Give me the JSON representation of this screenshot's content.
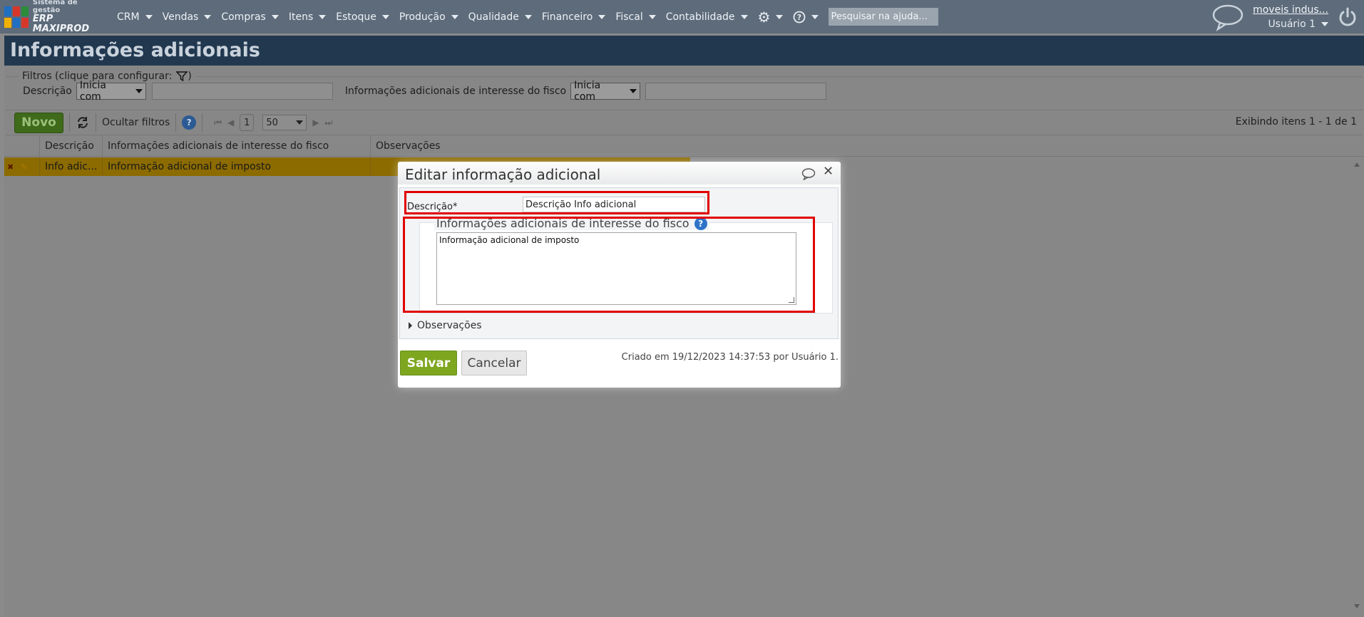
{
  "brand": {
    "line1": "Sistema de gestão",
    "line2": "ERP MAXIPROD",
    "colors": [
      "#1f6fc2",
      "#d7372b",
      "#2b8c3a",
      "#f2b100"
    ]
  },
  "nav": {
    "items": [
      "CRM",
      "Vendas",
      "Compras",
      "Itens",
      "Estoque",
      "Produção",
      "Qualidade",
      "Financeiro",
      "Fiscal",
      "Contabilidade"
    ],
    "settings_icon": "gear-icon",
    "help_icon": "help-circle-icon",
    "help_search_placeholder": "Pesquisar na ajuda..."
  },
  "account": {
    "company": "moveis indus...",
    "user": "Usuário 1"
  },
  "page": {
    "title": "Informações adicionais"
  },
  "filters": {
    "legend": "Filtros (clique para configurar:",
    "legend_close": ")",
    "field1_label": "Descrição",
    "field1_operator": "Inicia com",
    "field2_label": "Informações adicionais de interesse do fisco",
    "field2_operator": "Inicia com"
  },
  "toolbar": {
    "new_label": "Novo",
    "hide_filters_label": "Ocultar filtros",
    "page_number": "1",
    "per_page": "50",
    "count_text": "Exibindo itens 1 - 1 de 1"
  },
  "grid": {
    "columns": [
      "Descrição",
      "Informações adicionais de interesse do fisco",
      "Observações"
    ],
    "rows": [
      {
        "descricao": "Info adic...",
        "fisco": "Informação adicional de imposto",
        "obs": ""
      }
    ]
  },
  "modal": {
    "title": "Editar informação adicional",
    "desc_label": "Descrição*",
    "desc_value": "Descrição Info adicional",
    "fisco_legend": "Informações adicionais de interesse do fisco",
    "fisco_value": "Informação adicional de imposto",
    "obs_label": "Observações",
    "save_label": "Salvar",
    "cancel_label": "Cancelar",
    "created_text": "Criado em 19/12/2023 14:37:53 por Usuário 1."
  }
}
